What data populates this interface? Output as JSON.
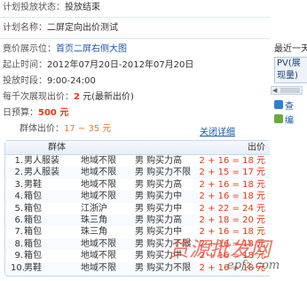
{
  "header": {
    "status_label": "计划投放状态：",
    "status_value": "投放结束",
    "name_label": "计划名称：",
    "name_value": "二屏定向出价测试"
  },
  "details": {
    "position_label": "竟价展示位：",
    "position_value": "首页二屏右侧大图",
    "period_label": "起止时间：",
    "period_value": "2012年07月20日-2012年07月20日",
    "slot_label": "投放时段：",
    "slot_value": "9:00-24:00",
    "bid_label": "每千次展现出价：",
    "bid_value": "2",
    "bid_unit": "元(最新出价)",
    "budget_label": "日预算：",
    "budget_value": "500 元",
    "group_bid_label": "群体出价：",
    "group_bid_value": "17 ~ 35 元",
    "close_link": "关闭详细"
  },
  "table": {
    "col_group": "群体",
    "col_price": "出价",
    "rows": [
      {
        "num": "1.",
        "group": "男人服装",
        "region": "地域不限",
        "action": "男 购买力高",
        "price": "2 + 16 = 18 元"
      },
      {
        "num": "2.",
        "group": "男人服装",
        "region": "地域不限",
        "action": "男 购买力不限",
        "price": "2 + 15 = 17 元"
      },
      {
        "num": "3.",
        "group": "男鞋",
        "region": "地域不限",
        "action": "男 购买力高",
        "price": "2 + 16 = 18 元"
      },
      {
        "num": "4.",
        "group": "箱包",
        "region": "地域不限",
        "action": "男 购买力中",
        "price": "2 + 16 = 18 元"
      },
      {
        "num": "5.",
        "group": "箱包",
        "region": "江浙沪",
        "action": "男 购买力中",
        "price": "2 + 22 = 24 元"
      },
      {
        "num": "6.",
        "group": "箱包",
        "region": "珠三角",
        "action": "男 购买力高",
        "price": "2 + 18 = 20 元"
      },
      {
        "num": "7.",
        "group": "箱包",
        "region": "珠三角",
        "action": "男 购买力中",
        "price": "2 + 16 = 18 元"
      },
      {
        "num": "8.",
        "group": "箱包",
        "region": "地域不限",
        "action": "男 购买力不限",
        "price": "2 + 16 = 18 元"
      },
      {
        "num": "9.",
        "group": "箱包",
        "region": "地域不限",
        "action": "男 购买力中",
        "price": "2 + 16 = 18 元"
      },
      {
        "num": "10.",
        "group": "男鞋",
        "region": "地域不限",
        "action": "男 购买力不限",
        "price": "2 + 16 = 18 元"
      }
    ]
  },
  "sidebar": {
    "title": "最近一天",
    "pv_text": "PV(展现量)",
    "link_1": "查",
    "link_2": "编"
  },
  "watermark": {
    "text": "货源批发网",
    "subtext": "epfz.com"
  },
  "colors": {
    "accent_red": "#e8380d",
    "link_blue": "#1a56b0",
    "table_border": "#c6d8ea"
  }
}
